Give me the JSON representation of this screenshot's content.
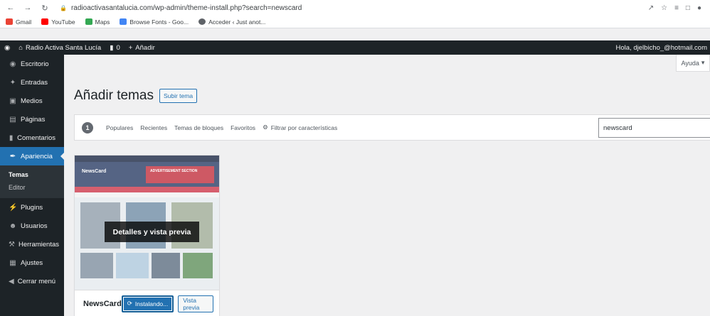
{
  "browser": {
    "url": "radioactivasantalucia.com/wp-admin/theme-install.php?search=newscard",
    "bookmarks": [
      "Gmail",
      "YouTube",
      "Maps",
      "Browse Fonts - Goo...",
      "Acceder ‹ Just anot..."
    ]
  },
  "adminbar": {
    "site_name": "Radio Activa Santa Lucía",
    "comments_count": "0",
    "new_label": "Añadir",
    "greeting": "Hola, djelbicho_@hotmail.com"
  },
  "sidebar": {
    "items": [
      {
        "label": "Escritorio",
        "icon": "dashboard-icon"
      },
      {
        "label": "Entradas",
        "icon": "pin-icon"
      },
      {
        "label": "Medios",
        "icon": "media-icon"
      },
      {
        "label": "Páginas",
        "icon": "page-icon"
      },
      {
        "label": "Comentarios",
        "icon": "comment-icon"
      },
      {
        "label": "Apariencia",
        "icon": "brush-icon"
      }
    ],
    "submenu": [
      "Temas",
      "Editor"
    ],
    "items_after": [
      {
        "label": "Plugins",
        "icon": "plug-icon"
      },
      {
        "label": "Usuarios",
        "icon": "users-icon"
      },
      {
        "label": "Herramientas",
        "icon": "wrench-icon"
      },
      {
        "label": "Ajustes",
        "icon": "settings-icon"
      },
      {
        "label": "Cerrar menú",
        "icon": "collapse-icon"
      }
    ]
  },
  "help_label": "Ayuda",
  "page": {
    "title": "Añadir temas",
    "upload_label": "Subir tema"
  },
  "filters": {
    "count": "1",
    "tabs": [
      "Populares",
      "Recientes",
      "Temas de bloques",
      "Favoritos"
    ],
    "feature_filter": "Filtrar por características",
    "search_value": "newscard"
  },
  "theme": {
    "name": "NewsCard",
    "overlay": "Detalles y vista previa",
    "install_label": "Instalando...",
    "preview_label": "Vista previa",
    "shot_logo": "NewsCard",
    "shot_ad": "ADVERTISEMENT SECTION"
  },
  "colors": {
    "admin_dark": "#1d2327",
    "accent": "#2271b1"
  }
}
